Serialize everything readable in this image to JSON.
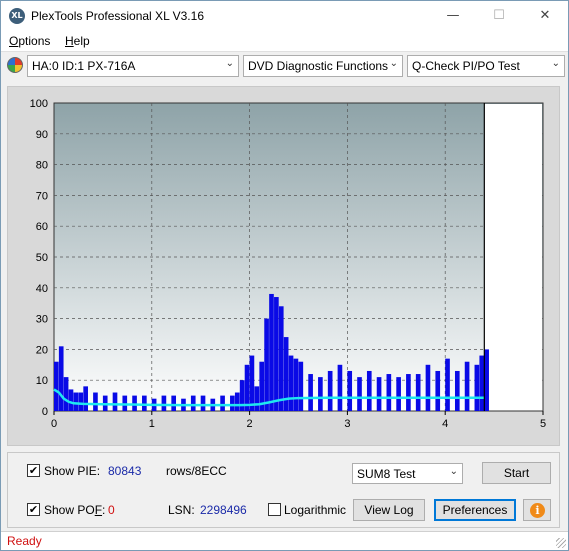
{
  "window": {
    "title": "PlexTools Professional XL V3.16",
    "icon_text": "XL",
    "minimize_glyph": "—",
    "maximize_glyph": "☐",
    "close_glyph": "✕"
  },
  "menu": {
    "items": [
      {
        "underline": "O",
        "rest": "ptions"
      },
      {
        "underline": "H",
        "rest": "elp"
      }
    ]
  },
  "toolbar": {
    "drive": "HA:0 ID:1  PX-716A",
    "function": "DVD Diagnostic Functions",
    "test": "Q-Check PI/PO Test",
    "dropdown_glyph": "⌄"
  },
  "chart_data": {
    "type": "bar",
    "xlabel": "",
    "ylabel": "",
    "xlim": [
      0,
      5
    ],
    "ylim": [
      0,
      100
    ],
    "x_ticks": [
      "0",
      "1",
      "2",
      "3",
      "4",
      "5"
    ],
    "y_ticks": [
      "0",
      "10",
      "20",
      "30",
      "40",
      "50",
      "60",
      "70",
      "80",
      "90",
      "100"
    ],
    "grid": true,
    "end_marker_x": 4.4,
    "colors": {
      "plot_bg_top": "#8ea3a8",
      "plot_bg_bottom": "#ffffff",
      "bars": "#0a0ae6",
      "avg_line": "#1ee8f0",
      "grid": "#555555"
    },
    "series": [
      {
        "kind": "bars",
        "x": [
          0.0,
          0.05,
          0.1,
          0.15,
          0.2,
          0.25,
          0.3,
          0.4,
          0.5,
          0.6,
          0.7,
          0.8,
          0.9,
          1.0,
          1.1,
          1.2,
          1.3,
          1.4,
          1.5,
          1.6,
          1.7,
          1.8,
          1.85,
          1.9,
          1.95,
          2.0,
          2.05,
          2.1,
          2.15,
          2.2,
          2.25,
          2.3,
          2.35,
          2.4,
          2.45,
          2.5,
          2.6,
          2.7,
          2.8,
          2.9,
          3.0,
          3.1,
          3.2,
          3.3,
          3.4,
          3.5,
          3.6,
          3.7,
          3.8,
          3.9,
          4.0,
          4.1,
          4.2,
          4.3,
          4.35,
          4.4
        ],
        "y": [
          16,
          21,
          11,
          7,
          6,
          6,
          8,
          6,
          5,
          6,
          5,
          5,
          5,
          4,
          5,
          5,
          4,
          5,
          5,
          4,
          5,
          5,
          6,
          10,
          15,
          18,
          8,
          16,
          30,
          38,
          37,
          34,
          24,
          18,
          17,
          16,
          12,
          11,
          13,
          15,
          13,
          11,
          13,
          11,
          12,
          11,
          12,
          12,
          15,
          13,
          17,
          13,
          16,
          15,
          18,
          20
        ]
      },
      {
        "kind": "line",
        "name": "",
        "x": [
          0.0,
          0.05,
          0.1,
          0.15,
          0.2,
          0.3,
          0.5,
          0.8,
          1.0,
          1.3,
          1.6,
          1.9,
          2.0,
          2.1,
          2.2,
          2.3,
          2.4,
          2.5,
          2.8,
          3.2,
          3.6,
          4.0,
          4.4
        ],
        "y": [
          7,
          6,
          4,
          3,
          2.5,
          2.3,
          2.2,
          2.1,
          2.0,
          1.9,
          1.9,
          1.9,
          2.0,
          2.2,
          2.8,
          3.5,
          4.0,
          4.2,
          4.3,
          4.3,
          4.3,
          4.3,
          4.3
        ]
      }
    ]
  },
  "bottom": {
    "show_pie_label": "Show PIE:",
    "pie_value": "80843",
    "rows_label": "rows/8ECC",
    "show_pof_label_pre": "Show PO",
    "show_pof_label_u": "F",
    "show_pof_label_post": ":",
    "pof_value": "0",
    "lsn_label": "LSN:",
    "lsn_value": "2298496",
    "logarithmic_label": "Logarithmic",
    "sum_test": "SUM8 Test",
    "start_label": "Start",
    "view_log_label": "View Log",
    "preferences_label": "Preferences",
    "check_mark": "✔",
    "info_glyph": "i"
  },
  "status": {
    "text": "Ready"
  }
}
